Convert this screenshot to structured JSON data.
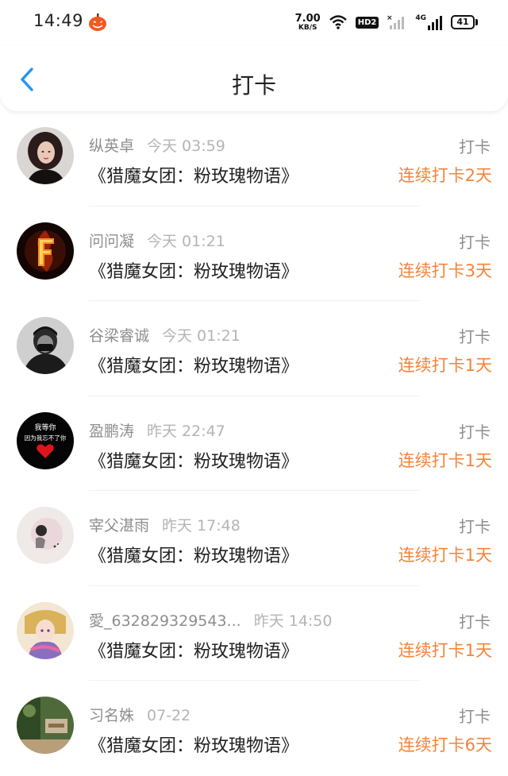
{
  "status_bar": {
    "time": "14:49",
    "net_speed_value": "7.00",
    "net_speed_unit": "KB/S",
    "hd_label": "HD2",
    "network_label": "4G",
    "battery": "41"
  },
  "header": {
    "title": "打卡",
    "accent_color": "#2196F3"
  },
  "checkins": [
    {
      "name": "纵英卓",
      "time": "今天 03:59",
      "book": "《猎魔女团：粉玫瑰物语》",
      "action": "打卡",
      "streak": "连续打卡2天"
    },
    {
      "name": "问问凝",
      "time": "今天 01:21",
      "book": "《猎魔女团：粉玫瑰物语》",
      "action": "打卡",
      "streak": "连续打卡3天"
    },
    {
      "name": "谷梁睿诚",
      "time": "今天 01:21",
      "book": "《猎魔女团：粉玫瑰物语》",
      "action": "打卡",
      "streak": "连续打卡1天"
    },
    {
      "name": "盈鹏涛",
      "time": "昨天 22:47",
      "book": "《猎魔女团：粉玫瑰物语》",
      "action": "打卡",
      "streak": "连续打卡1天"
    },
    {
      "name": "宰父湛雨",
      "time": "昨天 17:48",
      "book": "《猎魔女团：粉玫瑰物语》",
      "action": "打卡",
      "streak": "连续打卡1天"
    },
    {
      "name": "愛_632829329543...",
      "time": "昨天 14:50",
      "book": "《猎魔女团：粉玫瑰物语》",
      "action": "打卡",
      "streak": "连续打卡1天"
    },
    {
      "name": "习名姝",
      "time": "07-22",
      "book": "《猎魔女团：粉玫瑰物语》",
      "action": "打卡",
      "streak": "连续打卡6天"
    }
  ],
  "avatar_4_text": [
    "我等你",
    "因为我忘不了你"
  ],
  "streak_color": "#F5833A"
}
